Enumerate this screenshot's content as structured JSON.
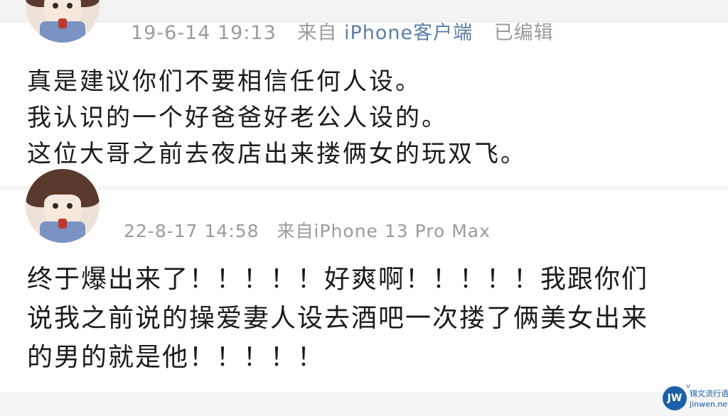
{
  "post1": {
    "timestamp": "19-6-14 19:13",
    "source_prefix": "来自",
    "source_link": "iPhone客户端",
    "edited_label": "已编辑",
    "lines": [
      "真是建议你们不要相信任何人设。",
      "我认识的一个好爸爸好老公人设的。",
      "这位大哥之前去夜店出来搂俩女的玩双飞。"
    ]
  },
  "post2": {
    "timestamp": "22-8-17 14:58",
    "source": "来自iPhone 13 Pro Max",
    "lines": [
      "终于爆出来了！！！！！好爽啊！！！！！我跟你们",
      "说我之前说的操爱妻人设去酒吧一次搂了俩美女出来",
      "的男的就是他！！！！！"
    ]
  },
  "watermark": {
    "logo": "JW",
    "line1": "锦文流行语",
    "line2": "jinwen.net"
  },
  "icons": {
    "post2_menu": "more-icon"
  }
}
